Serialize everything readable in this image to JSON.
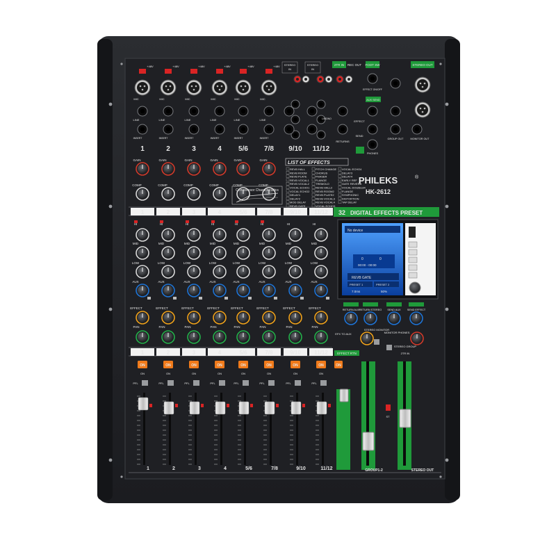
{
  "brand": {
    "name": "PHILEKS",
    "registered": "®",
    "model": "HK-2612"
  },
  "channels": [
    "1",
    "2",
    "3",
    "4",
    "5/6",
    "7/8",
    "9/10",
    "11/12"
  ],
  "top_labels": {
    "phantom": "+48V",
    "mic": "MIC",
    "line": "LINE",
    "insert": "INSERT",
    "stereo_in": "STEREO IN",
    "two_tr_in": "2TR IN",
    "rec_out": "REC OUT",
    "foot_sw": "FOOT SW",
    "stereo_out": "STEREO OUT",
    "effect_onoff": "EFFECT ON/OFF",
    "aux_send": "AUX SEND",
    "returns": "RETURNS",
    "phones": "PHONES",
    "group_out": "GROUP OUT",
    "monitor_out": "MONITOR OUT",
    "send": "SEND",
    "effect": "EFFECT",
    "lmono": "L/MONO"
  },
  "strip_labels": {
    "gain": "GAIN",
    "comp": "COMP",
    "hi": "HI",
    "mid": "MID",
    "low": "LOW",
    "aux": "AUX",
    "pre": "PRE",
    "effect": "EFFECT",
    "pan": "PAN",
    "on": "ON",
    "pfl": "PFL"
  },
  "compressor_title": "Compressor Characteristics",
  "effects_list": {
    "title": "LIST OF EFFECTS",
    "col1": [
      "REVB HALL",
      "REVB ROOM",
      "REVB PLATE",
      "REVB VOCAL1",
      "REVB VOCAL2",
      "VOCAL ECHO1",
      "VOCAL ECHO2",
      "DELAY1",
      "DELAY2",
      "MOD DELAY",
      "REVB GATE"
    ],
    "col2": [
      "PITCH CHANGE",
      "CHORUS",
      "PHASER",
      "FLANGE",
      "TREMOLO",
      "REVB HALL2",
      "REVB ROOM2",
      "REVB PLATE2",
      "REVB VOCAL3",
      "REVB VOCAL4",
      "VOCAL ECHO3"
    ],
    "col3": [
      "VOCAL ECHO4",
      "DELAY3",
      "DELAY4",
      "EARLY REF",
      "GATE REVERB",
      "VOCAL DOUBLER",
      "FLANGE",
      "SYMPHONIC",
      "DISTORTION",
      "TAP DELAY"
    ]
  },
  "preset_banner": {
    "count": "32",
    "text": "DIGITAL EFFECTS PRESET"
  },
  "display": {
    "header": "No device",
    "row1": "0",
    "row1b": "0",
    "time": "00:00 - 00:00",
    "preset_name": "REVB GATE",
    "preset_sel": "PRESET 1",
    "preset_sel2": "PRESET 2",
    "value": "7.0ms",
    "percent": "50%"
  },
  "master_labels": {
    "return_aux": "RETURN AUX",
    "return_stereo": "RETURN STEREO",
    "send_aux": "SEND AUX",
    "send_effect": "SEND EFFECT",
    "efx_to_aux": "EFX TO AUX",
    "stereo_monitor": "STEREO MONITOR",
    "monitor_phones": "MONITOR PHONES",
    "stereo_group": "STEREO GROUP",
    "two_tr_in": "2TR IN",
    "effect_rtn": "EFFECT RTN",
    "group_12": "GROUP1-2",
    "stereo_out": "STEREO OUT",
    "st": "ST"
  },
  "colors": {
    "chassis": "#23252a",
    "panel": "#1f2024",
    "on_button": "#f07a1a",
    "red_button": "#d92424",
    "green_accent": "#1f9a3a",
    "screen": "#1d6fd0"
  }
}
